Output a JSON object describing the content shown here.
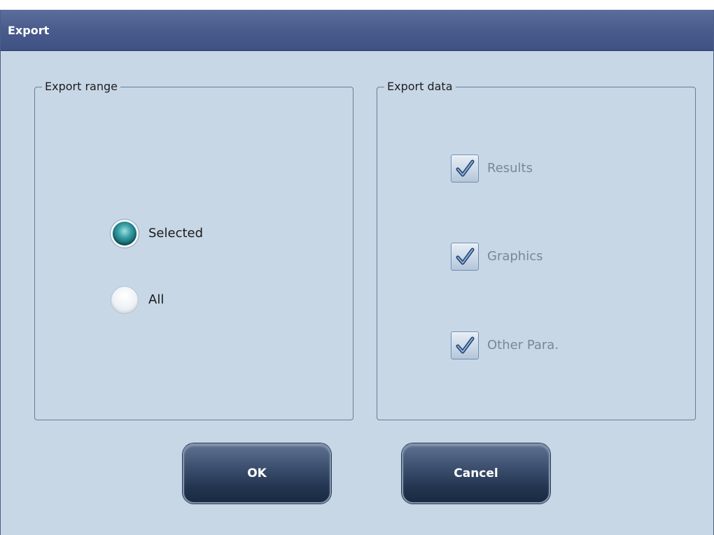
{
  "window": {
    "title": "Export"
  },
  "export_range": {
    "legend": "Export range",
    "options": [
      {
        "label": "Selected",
        "checked": true
      },
      {
        "label": "All",
        "checked": false
      }
    ]
  },
  "export_data": {
    "legend": "Export data",
    "items": [
      {
        "label": "Results",
        "checked": true,
        "enabled": false
      },
      {
        "label": "Graphics",
        "checked": true,
        "enabled": false
      },
      {
        "label": "Other Para.",
        "checked": true,
        "enabled": false
      }
    ]
  },
  "buttons": {
    "ok_label": "OK",
    "cancel_label": "Cancel"
  },
  "icons": {
    "radio_selected": "radio-selected-icon",
    "radio_unselected": "radio-unselected-icon",
    "checkbox_checked": "checkmark-icon"
  },
  "colors": {
    "title_bar": "#4a5d8d",
    "dialog_background": "#c7d7e6",
    "radio_accent": "#1f7a83",
    "button_dark": "#22344f",
    "disabled_text": "#7b8794"
  }
}
